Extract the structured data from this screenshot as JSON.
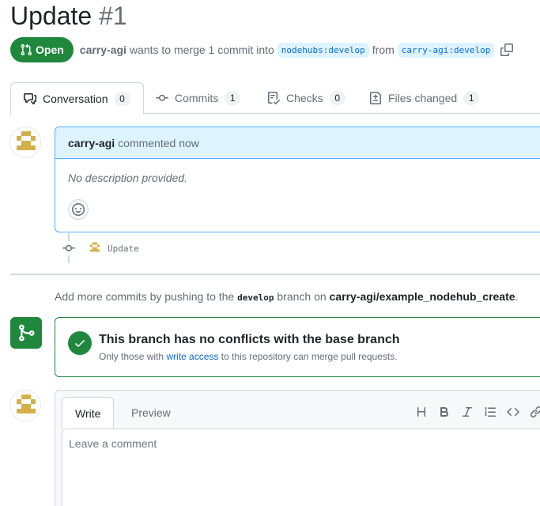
{
  "pr": {
    "title": "Update",
    "number": "#1",
    "state": "Open",
    "author": "carry-agi",
    "merge_text": "wants to merge 1 commit into",
    "base_branch": "nodehubs:develop",
    "from_text": "from",
    "head_branch": "carry-agi:develop"
  },
  "tabs": [
    {
      "label": "Conversation",
      "count": "0",
      "icon": "comment-discussion-icon"
    },
    {
      "label": "Commits",
      "count": "1",
      "icon": "git-commit-icon"
    },
    {
      "label": "Checks",
      "count": "0",
      "icon": "checklist-icon"
    },
    {
      "label": "Files changed",
      "count": "1",
      "icon": "file-diff-icon"
    }
  ],
  "comment": {
    "author": "carry-agi",
    "action": "commented now",
    "body": "No description provided."
  },
  "commit": {
    "message": "Update"
  },
  "push_hint": {
    "prefix": "Add more commits by pushing to the",
    "branch": "develop",
    "middle": "branch on",
    "repo": "carry-agi/example_nodehub_create",
    "suffix": "."
  },
  "merge": {
    "title": "This branch has no conflicts with the base branch",
    "sub_prefix": "Only those with",
    "sub_link": "write access",
    "sub_suffix": "to this repository can merge pull requests."
  },
  "editor": {
    "write_tab": "Write",
    "preview_tab": "Preview",
    "placeholder": "Leave a comment",
    "tools": [
      "heading-icon",
      "bold-icon",
      "italic-icon",
      "quote-icon",
      "code-icon",
      "link-icon"
    ]
  },
  "colors": {
    "open_green": "#1f883d",
    "link_blue": "#0969da",
    "comment_header": "#ddf4ff"
  }
}
